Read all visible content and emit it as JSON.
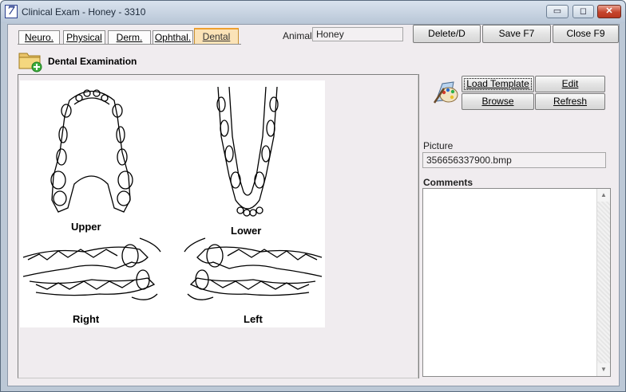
{
  "window": {
    "title": "Clinical Exam - Honey - 3310",
    "app_icon_glyph": "7",
    "minimize_glyph": "▭",
    "maximize_glyph": "◻",
    "close_glyph": "✕"
  },
  "tabs": [
    {
      "label": "Neuro."
    },
    {
      "label": "Physical"
    },
    {
      "label": "Derm."
    },
    {
      "label": "Ophthal."
    },
    {
      "label": "Dental"
    }
  ],
  "active_tab": "Dental",
  "animal": {
    "label": "Animal",
    "value": "Honey"
  },
  "toolbar": {
    "delete_label": "Delete/D",
    "save_label": "Save F7",
    "close_label": "Close F9"
  },
  "section": {
    "title": "Dental Examination"
  },
  "diagram": {
    "upper_label": "Upper",
    "lower_label": "Lower",
    "right_label": "Right",
    "left_label": "Left"
  },
  "template_buttons": {
    "load_template": "Load Template",
    "edit": "Edit",
    "browse": "Browse",
    "refresh": "Refresh"
  },
  "picture": {
    "label": "Picture",
    "value": "356656337900.bmp"
  },
  "comments": {
    "label": "Comments",
    "value": ""
  },
  "icons": {
    "folder": "folder-add-icon",
    "palette": "paint-palette-icon"
  },
  "colors": {
    "active_tab": "#fbe3b7",
    "client_bg": "#f0ecef",
    "close_button": "#c5452d"
  }
}
